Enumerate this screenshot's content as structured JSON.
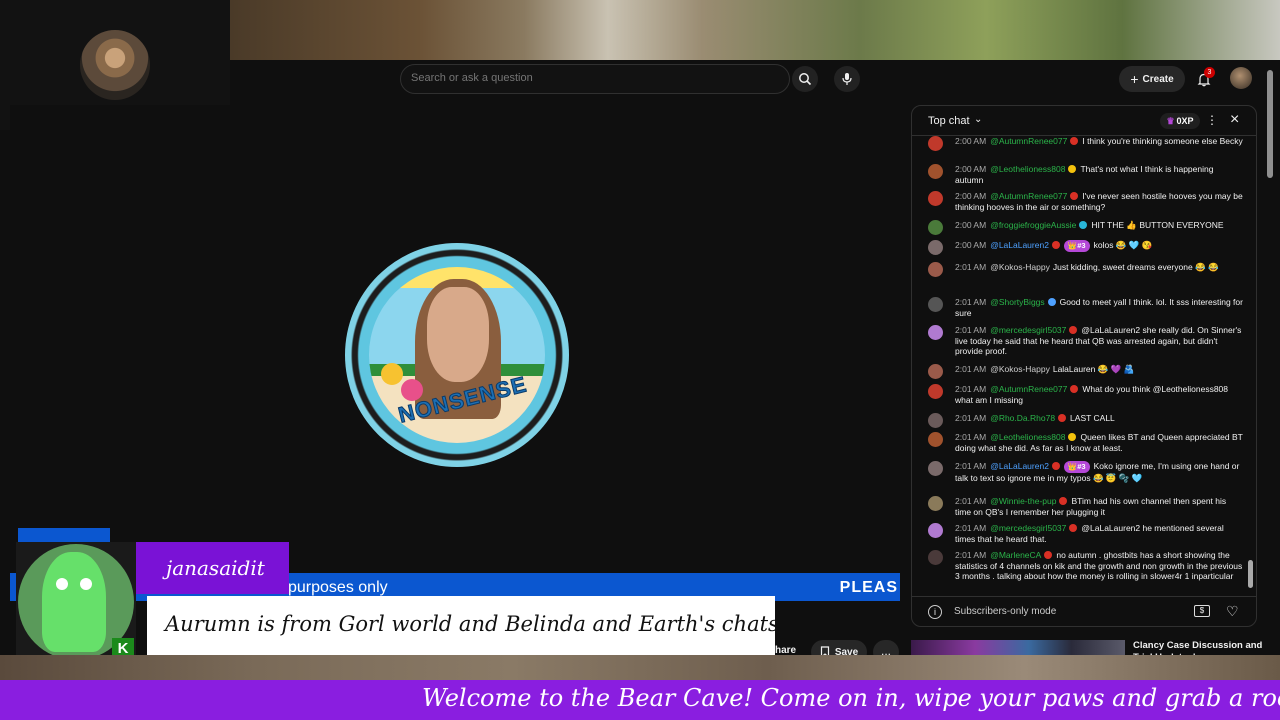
{
  "topbar": {
    "search_placeholder": "Search or ask a question",
    "create_label": "Create",
    "notification_count": "3"
  },
  "player": {
    "logo_text": "NONSENSE",
    "banner_left": "purposes only",
    "banner_right": "PLEAS"
  },
  "overlay": {
    "streamer_name": "janasaidit",
    "caption": "Aurumn is from Gorl world and Belinda and Earth's chats",
    "ticker": "Welcome to the Bear Cave! Come on in, wipe your paws and grab a rocking chair"
  },
  "actions": {
    "share_label": "hare",
    "save_label": "Save",
    "more_label": "..."
  },
  "chat": {
    "title": "Top chat",
    "xp_label": "0XP",
    "footer_text": "Subscribers-only mode",
    "messages": [
      {
        "time": "2:00 AM",
        "author": "@AutumnRenee077",
        "author_color": "green",
        "badge_color": "#d93025",
        "rank": "",
        "text": "I think you're thinking someone else Becky",
        "avatar_color": "#c0392b"
      },
      {
        "time": "2:00 AM",
        "author": "@Leothelioness808",
        "author_color": "green",
        "badge_color": "#f4c20d",
        "rank": "",
        "text": "That's not what I think is happening autumn",
        "avatar_color": "#a0522d"
      },
      {
        "time": "2:00 AM",
        "author": "@AutumnRenee077",
        "author_color": "green",
        "badge_color": "#d93025",
        "rank": "",
        "text": "I've never seen hostile hooves you may be thinking hooves in the air or something?",
        "avatar_color": "#c0392b"
      },
      {
        "time": "2:00 AM",
        "author": "@froggiefroggieAussie",
        "author_color": "green",
        "badge_color": "#29b6d8",
        "rank": "",
        "text": "HIT THE 👍 BUTTON EVERYONE",
        "avatar_color": "#4a7a3a"
      },
      {
        "time": "2:00 AM",
        "author": "@LaLaLauren2",
        "author_color": "blue",
        "badge_color": "#d93025",
        "rank": "👑#3",
        "text": "kolos 😂 🩵 😘",
        "avatar_color": "#7a6a6a"
      },
      {
        "time": "2:01 AM",
        "author": "@Kokos-Happy",
        "author_color": "grey",
        "badge_color": "",
        "rank": "",
        "text": "Just kidding, sweet dreams everyone 😂 😂",
        "avatar_color": "#9a5a4a"
      },
      {
        "time": "2:01 AM",
        "author": "@ShortyBiggs",
        "author_color": "green",
        "badge_color": "#4ea1ff",
        "rank": "",
        "text": "Good to meet yall I think. lol. It sss interesting for sure",
        "avatar_color": "#555555"
      },
      {
        "time": "2:01 AM",
        "author": "@mercedesgirl5037",
        "author_color": "green",
        "badge_color": "#d93025",
        "rank": "",
        "text": "@LaLaLauren2 she really did. On Sinner's live today he said that he heard that QB was arrested again, but didn't provide proof.",
        "avatar_color": "#b07ad0"
      },
      {
        "time": "2:01 AM",
        "author": "@Kokos-Happy",
        "author_color": "grey",
        "badge_color": "",
        "rank": "",
        "text": "LalaLauren 😂 💜 🫂",
        "avatar_color": "#9a5a4a"
      },
      {
        "time": "2:01 AM",
        "author": "@AutumnRenee077",
        "author_color": "green",
        "badge_color": "#d93025",
        "rank": "",
        "text": "What do you think @Leothelioness808 what am I missing",
        "avatar_color": "#c0392b"
      },
      {
        "time": "2:01 AM",
        "author": "@Rho.Da.Rho78",
        "author_color": "green",
        "badge_color": "#d93025",
        "rank": "",
        "text": "LAST CALL",
        "avatar_color": "#6a5a5a"
      },
      {
        "time": "2:01 AM",
        "author": "@Leothelioness808",
        "author_color": "green",
        "badge_color": "#f4c20d",
        "rank": "",
        "text": "Queen likes BT and Queen appreciated BT doing what she did. As far as I know at least.",
        "avatar_color": "#a0522d"
      },
      {
        "time": "2:01 AM",
        "author": "@LaLaLauren2",
        "author_color": "blue",
        "badge_color": "#d93025",
        "rank": "👑#3",
        "text": "Koko ignore me, I'm using one hand or talk to text so ignore me in my typos 😂 😇 🫧 🩵",
        "avatar_color": "#7a6a6a"
      },
      {
        "time": "2:01 AM",
        "author": "@Winnie-the-pup",
        "author_color": "green",
        "badge_color": "#d93025",
        "rank": "",
        "text": "BTim had his own channel then spent his time on QB's I remember her plugging it",
        "avatar_color": "#8a7a5a"
      },
      {
        "time": "2:01 AM",
        "author": "@mercedesgirl5037",
        "author_color": "green",
        "badge_color": "#d93025",
        "rank": "",
        "text": "@LaLaLauren2 he mentioned several times that he heard that.",
        "avatar_color": "#b07ad0"
      },
      {
        "time": "2:01 AM",
        "author": "@MarleneCA",
        "author_color": "green",
        "badge_color": "#d93025",
        "rank": "",
        "text": "no autumn . ghostbits has a short showing the statistics of 4 channels on kik and the growth and non growth in the previous 3 months . talking about how the money is rolling in slower4r 1 inparticular",
        "avatar_color": "#4a3a3a"
      }
    ]
  },
  "related": {
    "title": "Clancy Case Discussion and Trial Updates!"
  },
  "colors": {
    "ticker_bg": "#8a1ee0",
    "name_tag_bg": "#7a12d6",
    "banner_blue": "#0b57d0",
    "rank_pill": "#b548d8"
  }
}
